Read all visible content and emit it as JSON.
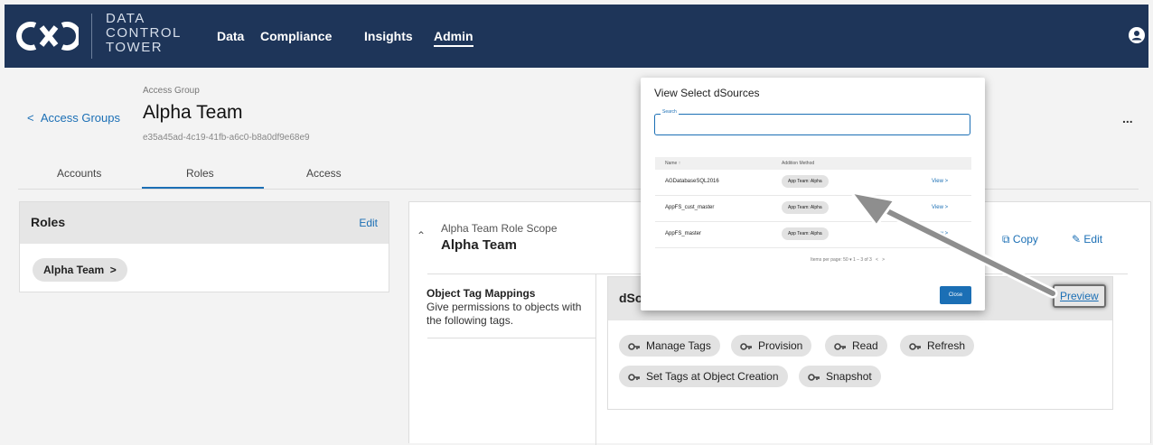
{
  "header": {
    "brand_line1": "DATA",
    "brand_line2": "CONTROL",
    "brand_line3": "TOWER",
    "nav": [
      "Data",
      "Compliance",
      "Insights",
      "Admin"
    ],
    "active_nav": "Admin",
    "color": "#1e3559"
  },
  "page": {
    "back_label": "Access Groups",
    "crumb": "Access Group",
    "title": "Alpha Team",
    "id": "e35a45ad-4c19-41fb-a6c0-b8a0df9e68e9",
    "tabs": [
      "Accounts",
      "Roles",
      "Access"
    ],
    "active_tab": "Roles",
    "more": "..."
  },
  "roles": {
    "title": "Roles",
    "edit": "Edit",
    "chip": "Alpha Team"
  },
  "scope": {
    "subtitle": "Alpha Team Role Scope",
    "title": "Alpha Team",
    "copy": "Copy",
    "edit": "Edit",
    "otm_title": "Object Tag Mappings",
    "otm_desc": "Give permissions to objects with the following tags.",
    "dsources_title": "dSo",
    "preview": "Preview",
    "permissions": [
      "Manage Tags",
      "Provision",
      "Read",
      "Refresh",
      "Set Tags at Object Creation",
      "Snapshot"
    ]
  },
  "modal": {
    "title": "View Select dSources",
    "search_label": "Search",
    "col_name": "Name ↑",
    "col_method": "Addition Method",
    "rows": [
      {
        "name": "AGDatabaseSQL2016",
        "method": "App Team: Alpha",
        "view": "View >"
      },
      {
        "name": "AppFS_cust_master",
        "method": "App Team: Alpha",
        "view": "View >"
      },
      {
        "name": "AppFS_master",
        "method": "App Team: Alpha",
        "view": "View >"
      }
    ],
    "pager": "Items per page: 50 ▾ 1 – 3 of 3",
    "close": "Close"
  }
}
